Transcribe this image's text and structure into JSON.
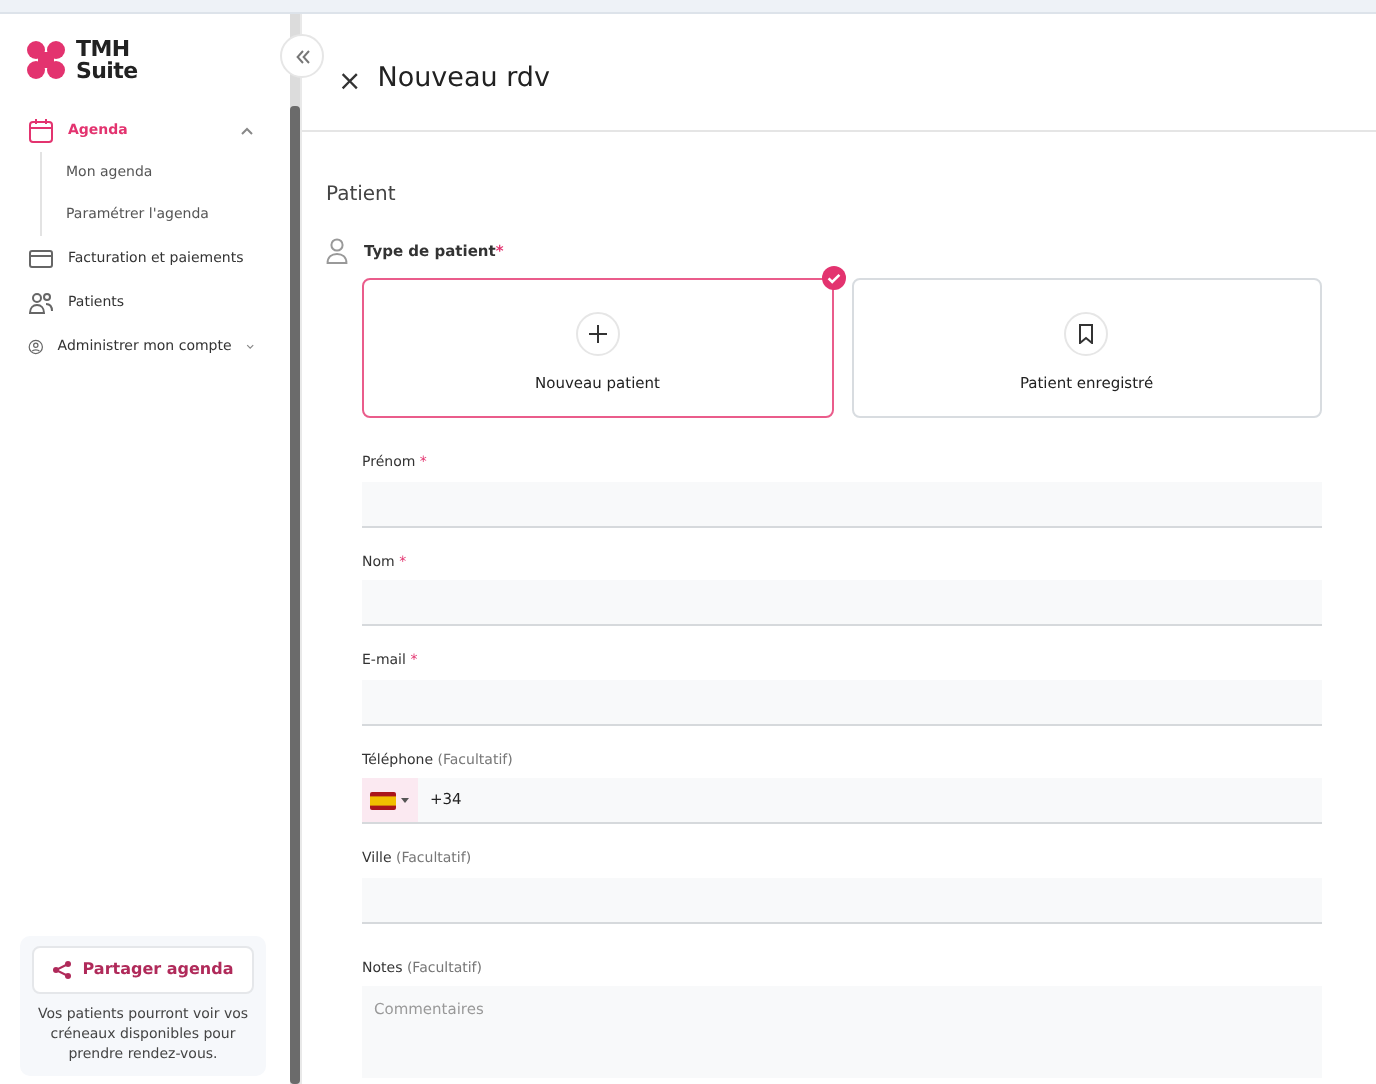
{
  "logo": {
    "line_1": "TMH",
    "line_2": "Suite"
  },
  "sidebar": {
    "items": [
      {
        "kind": "calendar",
        "label": "Agenda",
        "selected": true,
        "expanded": true,
        "children": [
          {
            "label": "Mon agenda"
          },
          {
            "label": "Paramétrer l'agenda"
          }
        ]
      },
      {
        "kind": "card",
        "label": "Facturation et paiements",
        "selected": false
      },
      {
        "kind": "people",
        "label": "Patients",
        "selected": false
      },
      {
        "kind": "account",
        "label": "Administrer mon compte",
        "selected": false,
        "expanded": false
      }
    ],
    "share": {
      "button": "Partager agenda",
      "text": "Vos patients pourront voir vos créneaux disponibles pour prendre rendez-vous."
    }
  },
  "panel": {
    "close": "×",
    "title": "Nouveau rdv",
    "section": "Patient",
    "patient_type": {
      "label": "Type de patient",
      "required_mark": "*",
      "options": [
        {
          "kind": "plus",
          "label": "Nouveau patient",
          "selected": true
        },
        {
          "kind": "bookmark",
          "label": "Patient enregistré",
          "selected": false
        }
      ]
    },
    "fields": [
      {
        "kind": "text",
        "label": "Prénom",
        "required_mark": "*"
      },
      {
        "kind": "text",
        "label": "Nom",
        "required_mark": "*"
      },
      {
        "kind": "text",
        "label": "E-mail",
        "required_mark": "*"
      },
      {
        "kind": "phone",
        "label": "Téléphone",
        "note": "(Facultatif)",
        "value": "+34"
      },
      {
        "kind": "text",
        "label": "Ville",
        "note": "(Facultatif)"
      },
      {
        "kind": "textarea",
        "label": "Notes",
        "note": "(Facultatif)",
        "placeholder": "Commentaires"
      }
    ]
  }
}
